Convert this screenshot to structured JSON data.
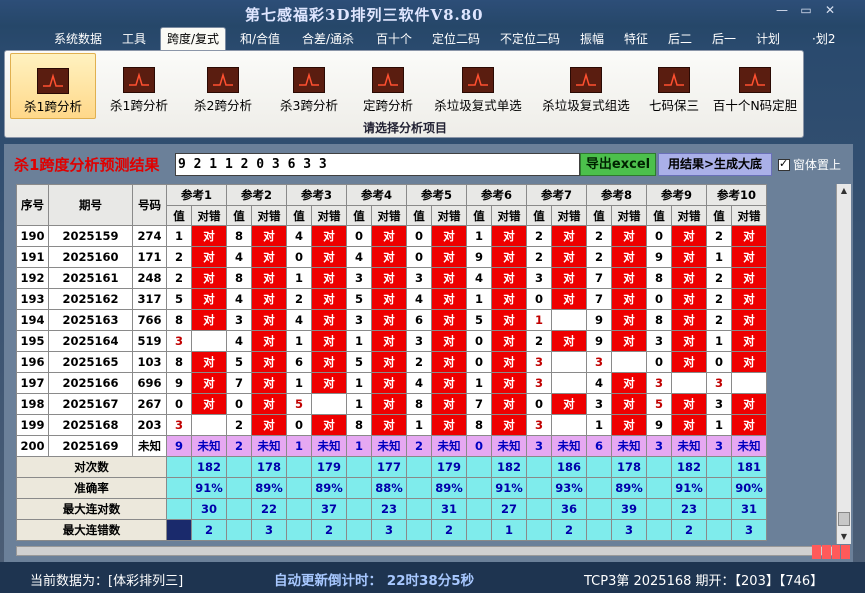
{
  "window": {
    "title": "第七感福彩3D排列三软件V8.80",
    "min": "—",
    "max": "▭",
    "close": "✕"
  },
  "menu": [
    "系统数据",
    "工具",
    "跨度/复式",
    "和/合值",
    "合差/通杀",
    "百十个",
    "定位二码",
    "不定位二码",
    "振幅",
    "特征",
    "后二",
    "后一",
    "计划",
    "·划2"
  ],
  "ribbon": {
    "buttons": [
      "杀1跨分析",
      "杀1跨分析",
      "杀2跨分析",
      "杀3跨分析",
      "定跨分析",
      "杀垃圾复式单选",
      "杀垃圾复式组选",
      "七码保三",
      "百十个N码定胆"
    ],
    "caption": "请选择分析项目"
  },
  "panel": {
    "result_label": "杀1跨度分析预测结果",
    "result_value": "9 2 1 1 2 0 3 6 3 3",
    "export_label": "导出excel",
    "generate_label": "用结果>生成大底",
    "ontop_label": "窗体置上"
  },
  "table": {
    "headers": {
      "seq": "序号",
      "period": "期号",
      "number": "号码"
    },
    "refs": [
      "参考1",
      "参考2",
      "参考3",
      "参考4",
      "参考5",
      "参考6",
      "参考7",
      "参考8",
      "参考9",
      "参考10"
    ],
    "sub_value": "值",
    "sub_result": "对错",
    "hit_text": "对",
    "unknown_text": "未知",
    "rows": [
      {
        "seq": "190",
        "period": "2025159",
        "number": "274",
        "vals": [
          1,
          8,
          4,
          0,
          0,
          1,
          2,
          2,
          0,
          2
        ],
        "res": [
          "r",
          "r",
          "r",
          "r",
          "r",
          "r",
          "r",
          "r",
          "r",
          "r"
        ],
        "hit": []
      },
      {
        "seq": "191",
        "period": "2025160",
        "number": "171",
        "vals": [
          2,
          4,
          0,
          4,
          0,
          9,
          2,
          2,
          9,
          1
        ],
        "res": [
          "r",
          "r",
          "r",
          "r",
          "r",
          "r",
          "r",
          "r",
          "r",
          "r"
        ],
        "hit": []
      },
      {
        "seq": "192",
        "period": "2025161",
        "number": "248",
        "vals": [
          2,
          8,
          1,
          3,
          3,
          4,
          3,
          7,
          8,
          2
        ],
        "res": [
          "r",
          "r",
          "r",
          "r",
          "r",
          "r",
          "r",
          "r",
          "r",
          "r"
        ],
        "hit": []
      },
      {
        "seq": "193",
        "period": "2025162",
        "number": "317",
        "vals": [
          5,
          4,
          2,
          5,
          4,
          1,
          0,
          7,
          0,
          2
        ],
        "res": [
          "r",
          "r",
          "r",
          "r",
          "r",
          "r",
          "r",
          "r",
          "r",
          "r"
        ],
        "hit": []
      },
      {
        "seq": "194",
        "period": "2025163",
        "number": "766",
        "vals": [
          8,
          3,
          4,
          3,
          6,
          5,
          1,
          9,
          8,
          2
        ],
        "res": [
          "r",
          "r",
          "r",
          "r",
          "r",
          "r",
          "w",
          "r",
          "r",
          "r"
        ],
        "hit": [
          6
        ]
      },
      {
        "seq": "195",
        "period": "2025164",
        "number": "519",
        "vals": [
          3,
          4,
          1,
          1,
          3,
          0,
          2,
          9,
          3,
          1
        ],
        "res": [
          "w",
          "r",
          "r",
          "r",
          "r",
          "r",
          "r",
          "r",
          "r",
          "r"
        ],
        "hit": [
          0
        ]
      },
      {
        "seq": "196",
        "period": "2025165",
        "number": "103",
        "vals": [
          8,
          5,
          6,
          5,
          2,
          0,
          3,
          3,
          0,
          0
        ],
        "res": [
          "r",
          "r",
          "r",
          "r",
          "r",
          "r",
          "w",
          "w",
          "r",
          "r"
        ],
        "hit": [
          6,
          7
        ]
      },
      {
        "seq": "197",
        "period": "2025166",
        "number": "696",
        "vals": [
          9,
          7,
          1,
          1,
          4,
          1,
          3,
          4,
          3,
          3
        ],
        "res": [
          "r",
          "r",
          "r",
          "r",
          "r",
          "r",
          "w",
          "r",
          "w",
          "w"
        ],
        "hit": [
          6,
          8,
          9
        ]
      },
      {
        "seq": "198",
        "period": "2025167",
        "number": "267",
        "vals": [
          0,
          0,
          5,
          1,
          8,
          7,
          0,
          3,
          5,
          3
        ],
        "res": [
          "r",
          "r",
          "w",
          "r",
          "r",
          "r",
          "r",
          "r",
          "r",
          "r"
        ],
        "hit": [
          2,
          8
        ]
      },
      {
        "seq": "199",
        "period": "2025168",
        "number": "203",
        "vals": [
          3,
          2,
          0,
          8,
          1,
          8,
          3,
          1,
          9,
          1
        ],
        "res": [
          "w",
          "r",
          "r",
          "r",
          "r",
          "r",
          "w",
          "r",
          "r",
          "r"
        ],
        "hit": [
          0,
          6
        ]
      },
      {
        "seq": "200",
        "period": "2025169",
        "number": "未知",
        "vals": [
          9,
          2,
          1,
          1,
          2,
          0,
          3,
          6,
          3,
          3
        ],
        "res": [
          "u",
          "u",
          "u",
          "u",
          "u",
          "u",
          "u",
          "u",
          "u",
          "u"
        ],
        "hit": []
      }
    ],
    "stats": [
      {
        "label": "对次数",
        "values": [
          "182",
          "178",
          "179",
          "177",
          "179",
          "182",
          "186",
          "178",
          "182",
          "181"
        ]
      },
      {
        "label": "准确率",
        "values": [
          "91%",
          "89%",
          "89%",
          "88%",
          "89%",
          "91%",
          "93%",
          "89%",
          "91%",
          "90%"
        ]
      },
      {
        "label": "最大连对数",
        "values": [
          "30",
          "22",
          "37",
          "23",
          "31",
          "27",
          "36",
          "39",
          "23",
          "31"
        ]
      },
      {
        "label": "最大连错数",
        "values": [
          "2",
          "3",
          "2",
          "3",
          "2",
          "1",
          "2",
          "3",
          "2",
          "3"
        ]
      }
    ]
  },
  "status": {
    "current": "当前数据为：[体彩排列三]",
    "update": "自动更新倒计时：  22时38分5秒",
    "tcp": "TCP3第 2025168 期开：【203】【746】"
  },
  "colors": {
    "wrong": "#ee0000",
    "stats_bg": "#7fecec",
    "unknown_bg": "#e6a8f2"
  }
}
